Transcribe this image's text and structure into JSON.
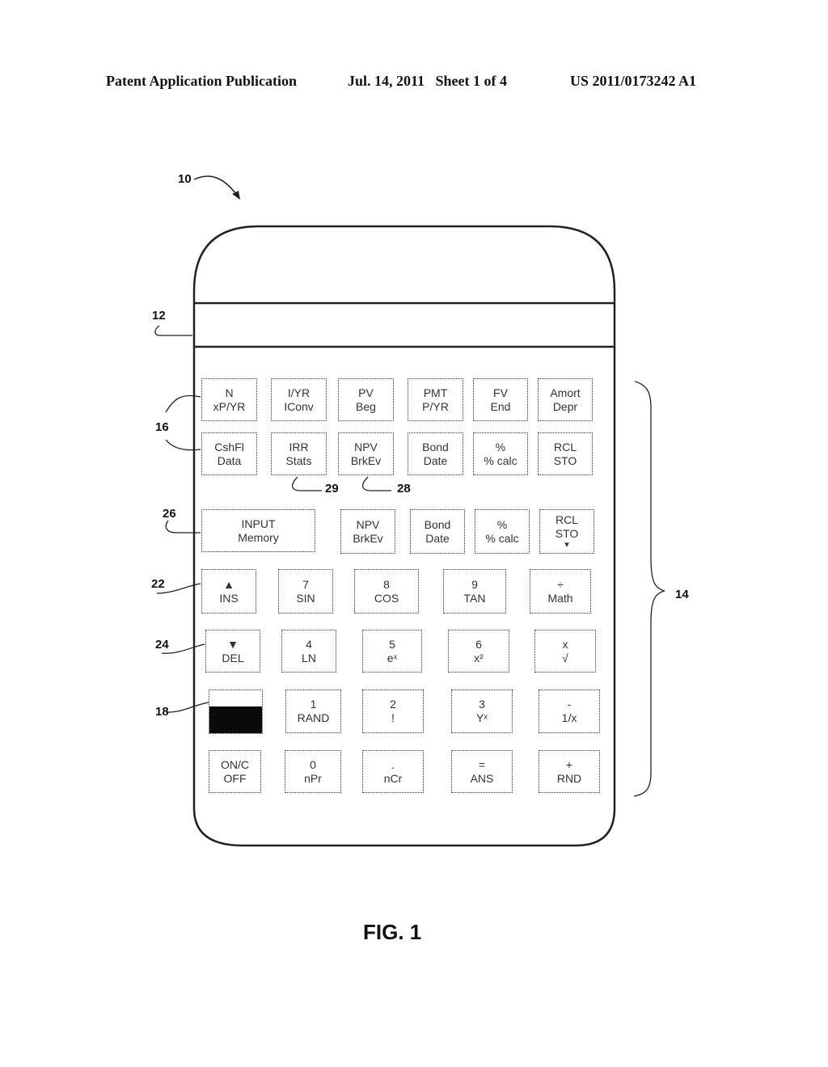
{
  "header": {
    "left": "Patent Application Publication",
    "middle": "Jul. 14, 2011   Sheet 1 of 4",
    "right": "US 2011/0173242 A1"
  },
  "figure_label": "FIG. 1",
  "reference_numerals": {
    "device": "10",
    "display": "12",
    "keypad": "14",
    "key_group": "16",
    "solar_cell": "18",
    "up_key": "22",
    "down_key": "24",
    "input_key": "26",
    "npv_key": "28",
    "irr_key": "29"
  },
  "keys": {
    "row1": [
      {
        "top": "N",
        "bottom": "xP/YR"
      },
      {
        "top": "I/YR",
        "bottom": "IConv"
      },
      {
        "top": "PV",
        "bottom": "Beg"
      },
      {
        "top": "PMT",
        "bottom": "P/YR"
      },
      {
        "top": "FV",
        "bottom": "End"
      },
      {
        "top": "Amort",
        "bottom": "Depr"
      }
    ],
    "row2": [
      {
        "top": "CshFl",
        "bottom": "Data"
      },
      {
        "top": "IRR",
        "bottom": "Stats"
      },
      {
        "top": "NPV",
        "bottom": "BrkEv"
      },
      {
        "top": "Bond",
        "bottom": "Date"
      },
      {
        "top": "%",
        "bottom": "% calc"
      },
      {
        "top": "RCL",
        "bottom": "STO"
      }
    ],
    "row3": [
      {
        "top": "INPUT",
        "bottom": "Memory"
      },
      {
        "top": "NPV",
        "bottom": "BrkEv"
      },
      {
        "top": "Bond",
        "bottom": "Date"
      },
      {
        "top": "%",
        "bottom": "% calc"
      },
      {
        "top": "RCL",
        "bottom": "STO",
        "mark": "▾"
      }
    ],
    "row4": [
      {
        "top": "▲",
        "bottom": "INS"
      },
      {
        "top": "7",
        "bottom": "SIN"
      },
      {
        "top": "8",
        "bottom": "COS"
      },
      {
        "top": "9",
        "bottom": "TAN"
      },
      {
        "top": "÷",
        "bottom": "Math"
      }
    ],
    "row5": [
      {
        "top": "▼",
        "bottom": "DEL"
      },
      {
        "top": "4",
        "bottom": "LN"
      },
      {
        "top": "5",
        "bottom": "eˣ"
      },
      {
        "top": "6",
        "bottom": "x²"
      },
      {
        "top": "x",
        "bottom": "√"
      }
    ],
    "row6": [
      {
        "top": "1",
        "bottom": "RAND"
      },
      {
        "top": "2",
        "bottom": "!"
      },
      {
        "top": "3",
        "bottom": "Yˣ"
      },
      {
        "top": "-",
        "bottom": "1/x"
      }
    ],
    "row7": [
      {
        "top": "ON/C",
        "bottom": "OFF"
      },
      {
        "top": "0",
        "bottom": "nPr"
      },
      {
        "top": ".",
        "bottom": "nCr"
      },
      {
        "top": "=",
        "bottom": "ANS"
      },
      {
        "top": "+",
        "bottom": "RND"
      }
    ]
  }
}
